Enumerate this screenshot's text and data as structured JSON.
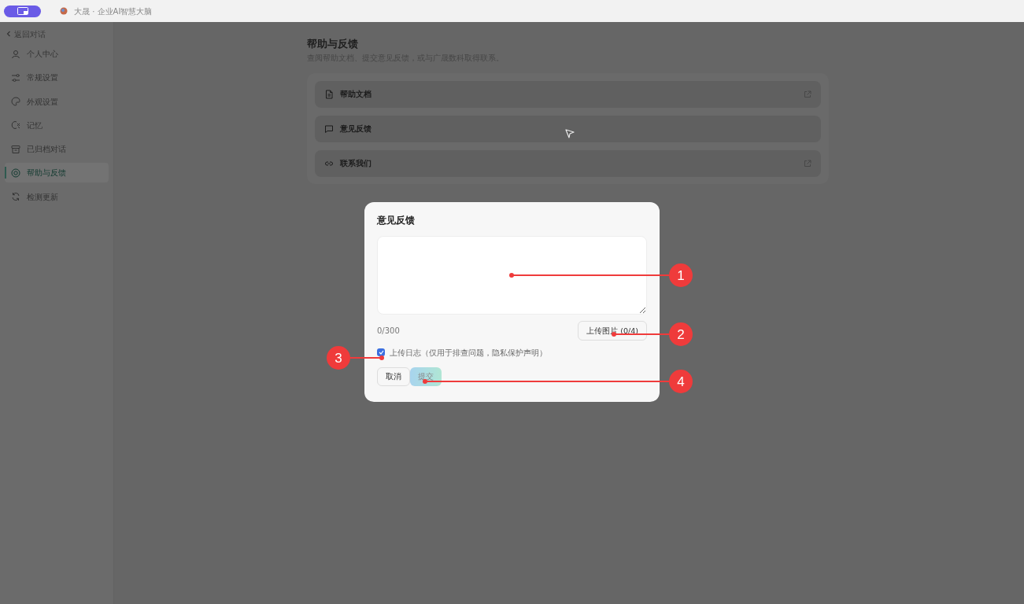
{
  "titlebar": {
    "title": "大晟 · 企业AI智慧大脑"
  },
  "sidebar": {
    "back": "返回对话",
    "items": [
      {
        "label": "个人中心",
        "selected": false
      },
      {
        "label": "常规设置",
        "selected": false
      },
      {
        "label": "外观设置",
        "selected": false
      },
      {
        "label": "记忆",
        "selected": false
      },
      {
        "label": "已归档对话",
        "selected": false
      },
      {
        "label": "帮助与反馈",
        "selected": true
      },
      {
        "label": "检测更新",
        "selected": false
      }
    ]
  },
  "page": {
    "title": "帮助与反馈",
    "subtitle": "查阅帮助文档、提交意见反馈，或与广晟数科取得联系。",
    "items": [
      {
        "label": "帮助文档",
        "external": true
      },
      {
        "label": "意见反馈",
        "external": false
      },
      {
        "label": "联系我们",
        "external": true
      }
    ]
  },
  "dialog": {
    "title": "意见反馈",
    "count": "0/300",
    "upload_button": "上传图片 (0/4)",
    "log_checkbox": {
      "label": "上传日志（仅用于排查问题，隐私保护声明）",
      "checked": true
    },
    "buttons": [
      {
        "label": "取消",
        "kind": "secondary",
        "disabled": false
      },
      {
        "label": "提交",
        "kind": "primary",
        "disabled": true
      }
    ]
  },
  "callouts": [
    {
      "label": "1"
    },
    {
      "label": "2"
    },
    {
      "label": "3"
    },
    {
      "label": "4"
    }
  ]
}
